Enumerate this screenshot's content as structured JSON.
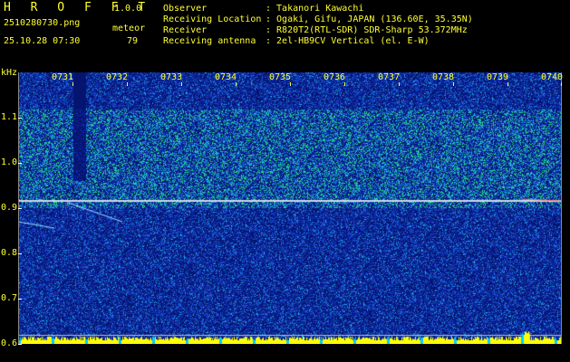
{
  "header": {
    "app_title": "H R O F F T",
    "version": "1.0.0",
    "filename": "2510280730.png",
    "datetime": "25.10.28 07:30",
    "meteor_label": "meteor",
    "meteor_count": "79"
  },
  "info": [
    {
      "key": "Observer",
      "value": ": Takanori Kawachi"
    },
    {
      "key": "Receiving Location",
      "value": ": Ogaki, Gifu, JAPAN (136.60E, 35.35N)"
    },
    {
      "key": "Receiver",
      "value": ": R820T2(RTL-SDR) SDR-Sharp 53.372MHz"
    },
    {
      "key": "Receiving antenna",
      "value": ": 2el-HB9CV Vertical (el. E-W)"
    }
  ],
  "axis": {
    "unit": "kHz",
    "y_ticks": [
      "1.1",
      "1.0",
      "0.9",
      "0.8",
      "0.7",
      "0.6"
    ],
    "x_ticks": [
      "0731",
      "0732",
      "0733",
      "0734",
      "0735",
      "0736",
      "0737",
      "0738",
      "0739",
      "0740"
    ]
  },
  "colors": {
    "text": "#ffff33",
    "background": "#000000",
    "spectrogram_base": "#0a1f8c",
    "carrier_line": "#cccccc",
    "bar_fill": "#ffff00",
    "bar_accent": "#00ccff"
  }
}
